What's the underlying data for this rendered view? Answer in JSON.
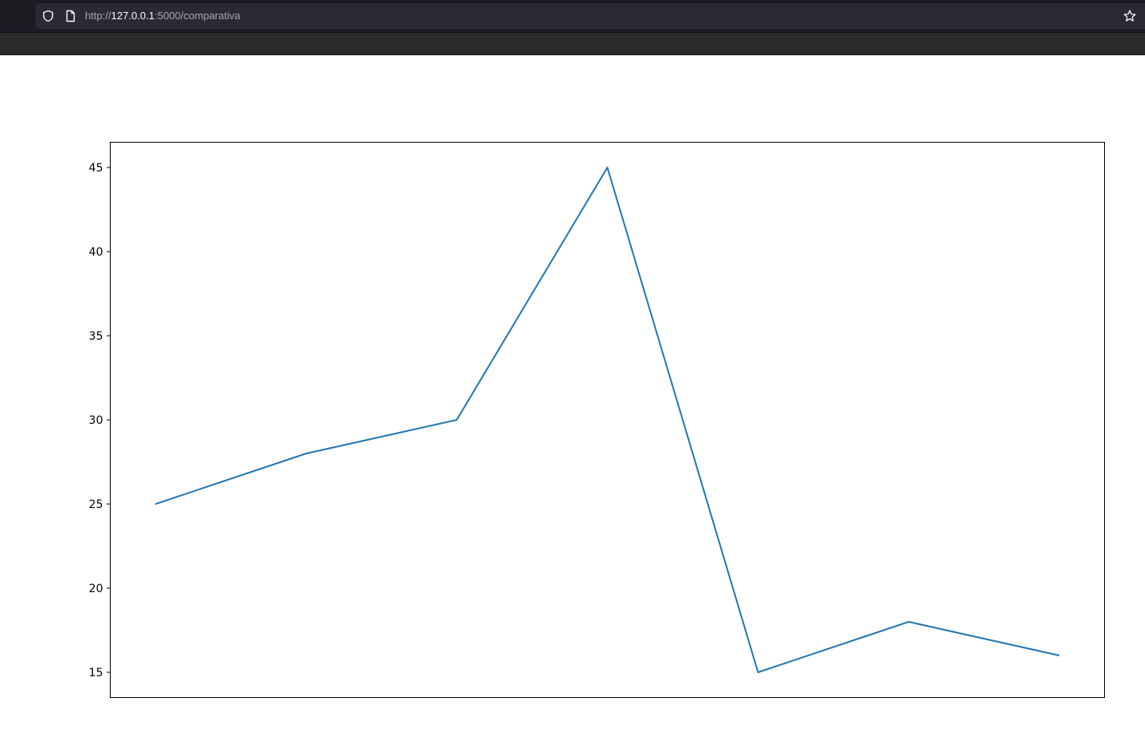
{
  "browser": {
    "url_scheme": "http://",
    "url_host": "127.0.0.1",
    "url_path": ":5000/comparativa",
    "icons": {
      "security": "shield-icon",
      "page": "page-icon",
      "bookmark": "star-icon"
    }
  },
  "chart_data": {
    "type": "line",
    "x": [
      0,
      1,
      2,
      3,
      4,
      5,
      6
    ],
    "series": [
      {
        "values": [
          25,
          28,
          30,
          45,
          15,
          18,
          16
        ],
        "color": "#1f77b4"
      }
    ],
    "yticks": [
      15,
      20,
      25,
      30,
      35,
      40,
      45
    ],
    "ylim": [
      13.5,
      46.5
    ],
    "title": "",
    "xlabel": "",
    "ylabel": "",
    "grid": false,
    "xticks_visible": false
  }
}
